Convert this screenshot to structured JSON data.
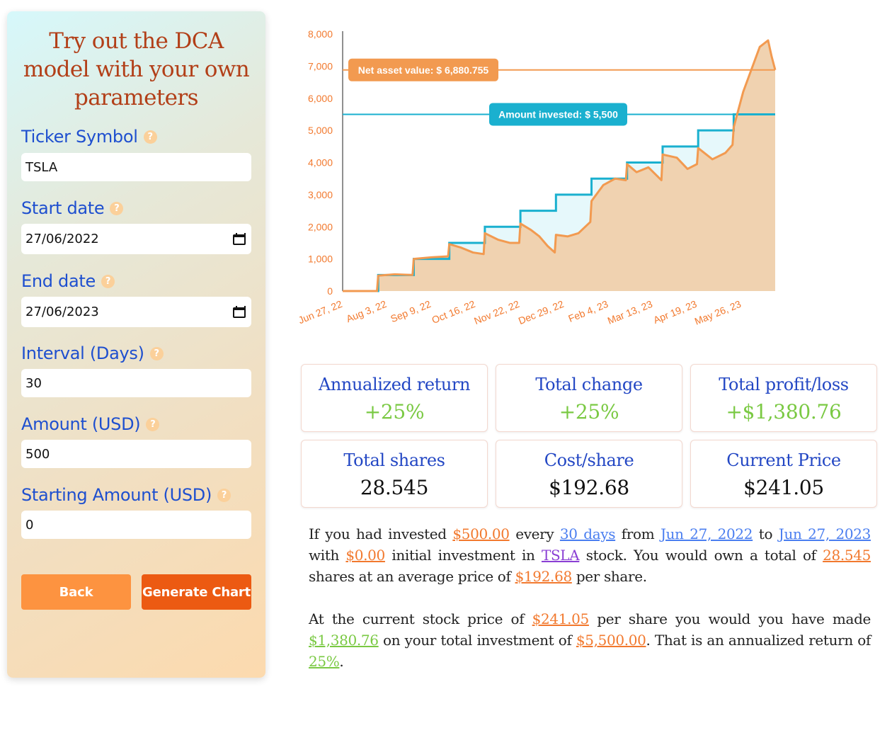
{
  "form": {
    "title_lines": [
      "Try out the DCA",
      "model with your own",
      "parameters"
    ],
    "fields": [
      {
        "label": "Ticker Symbol",
        "value": "TSLA",
        "type": "text"
      },
      {
        "label": "Start date",
        "value": "27/06/2022",
        "type": "date"
      },
      {
        "label": "End date",
        "value": "27/06/2023",
        "type": "date"
      },
      {
        "label": "Interval (Days)",
        "value": "30",
        "type": "text"
      },
      {
        "label": "Amount (USD)",
        "value": "500",
        "type": "text"
      },
      {
        "label": "Starting Amount (USD)",
        "value": "0",
        "type": "text"
      }
    ],
    "help_glyph": "?",
    "back_label": "Back",
    "generate_label": "Generate Chart"
  },
  "chart_data": {
    "type": "area",
    "x_tick_labels": [
      "Jun 27, 22",
      "Aug 3, 22",
      "Sep 9, 22",
      "Oct 16, 22",
      "Nov 22, 22",
      "Dec 29, 22",
      "Feb 4, 23",
      "Mar 13, 23",
      "Apr 19, 23",
      "May 26, 23"
    ],
    "y_tick_labels": [
      "0",
      "1,000",
      "2,000",
      "3,000",
      "4,000",
      "5,000",
      "6,000",
      "7,000",
      "8,000"
    ],
    "ylim": [
      0,
      8000
    ],
    "xlim": [
      "2022-06-27",
      "2023-06-27"
    ],
    "series": [
      {
        "name": "Amount invested",
        "color": "#1ab0cf",
        "x": [
          "2022-06-27",
          "2022-07-27",
          "2022-08-26",
          "2022-09-25",
          "2022-10-25",
          "2022-11-24",
          "2022-12-24",
          "2023-01-23",
          "2023-02-22",
          "2023-03-24",
          "2023-04-23",
          "2023-05-23",
          "2023-06-22"
        ],
        "y": [
          0,
          500,
          1000,
          1500,
          2000,
          2500,
          3000,
          3500,
          4000,
          4500,
          5000,
          5500,
          5500
        ]
      },
      {
        "name": "Net asset value",
        "color": "#f29a50",
        "fill": "#f0d2b0",
        "x": [
          "2022-06-27",
          "2022-07-26",
          "2022-07-27",
          "2022-08-10",
          "2022-08-25",
          "2022-08-26",
          "2022-09-10",
          "2022-09-24",
          "2022-09-25",
          "2022-10-05",
          "2022-10-15",
          "2022-10-24",
          "2022-10-25",
          "2022-11-05",
          "2022-11-15",
          "2022-11-23",
          "2022-11-24",
          "2022-12-03",
          "2022-12-10",
          "2022-12-17",
          "2022-12-23",
          "2022-12-24",
          "2023-01-03",
          "2023-01-12",
          "2023-01-22",
          "2023-01-23",
          "2023-02-02",
          "2023-02-12",
          "2023-02-21",
          "2023-02-22",
          "2023-03-02",
          "2023-03-12",
          "2023-03-23",
          "2023-03-24",
          "2023-04-05",
          "2023-04-14",
          "2023-04-22",
          "2023-04-23",
          "2023-05-05",
          "2023-05-16",
          "2023-05-22",
          "2023-05-23",
          "2023-05-31",
          "2023-06-07",
          "2023-06-14",
          "2023-06-21",
          "2023-06-24",
          "2023-06-27"
        ],
        "y": [
          0,
          0,
          480,
          520,
          500,
          1000,
          1050,
          1080,
          1460,
          1350,
          1200,
          1150,
          1800,
          1600,
          1500,
          1500,
          2100,
          1900,
          1700,
          1400,
          1200,
          1750,
          1700,
          1800,
          2150,
          2800,
          3300,
          3500,
          3450,
          3950,
          3700,
          3850,
          3450,
          4250,
          4150,
          3800,
          3950,
          4450,
          4100,
          4300,
          4550,
          5100,
          6200,
          6900,
          7600,
          7800,
          7300,
          6880.755
        ]
      }
    ],
    "annotations": [
      {
        "label": "Net asset value: $ 6,880.755",
        "value": 6880.755,
        "color": "#f29a50"
      },
      {
        "label": "Amount invested: $ 5,500",
        "value": 5500,
        "color": "#1ab0cf"
      }
    ]
  },
  "cards": {
    "annualized": {
      "label": "Annualized return",
      "value": "+25%"
    },
    "change": {
      "label": "Total change",
      "value": "+25%"
    },
    "profit": {
      "label": "Total profit/loss",
      "value": "+$1,380.76"
    },
    "shares": {
      "label": "Total shares",
      "value": "28.545"
    },
    "cost": {
      "label": "Cost/share",
      "value": "$192.68"
    },
    "price": {
      "label": "Current Price",
      "value": "$241.05"
    }
  },
  "summary": {
    "p1": {
      "t1": "If you had invested ",
      "amount": "$500.00",
      "t2": " every ",
      "interval": "30 days",
      "t3": " from ",
      "start": "Jun 27, 2022",
      "t4": " to ",
      "end": "Jun 27, 2023",
      "t5": " with ",
      "initial": "$0.00",
      "t6": " initial investment in ",
      "ticker": "TSLA",
      "t7": " stock. You would own a total of ",
      "shares": "28.545",
      "t8": " shares at an average price of ",
      "avg": "$192.68",
      "t9": " per share."
    },
    "p2": {
      "t1": "At the current stock price of ",
      "price": "$241.05",
      "t2": " per share you would you have made ",
      "profit": "$1,380.76",
      "t3": " on your total investment of ",
      "total": "$5,500.00",
      "t4": ". That is an annualized return of ",
      "ret": "25%",
      "t5": "."
    }
  }
}
